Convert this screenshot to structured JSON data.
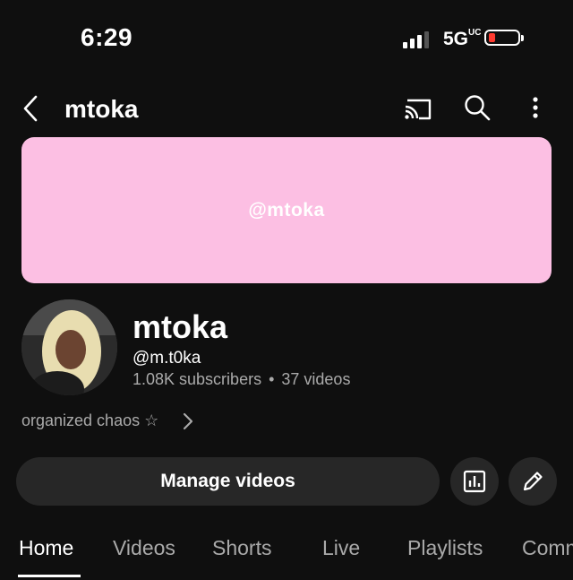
{
  "status_bar": {
    "time": "6:29",
    "network": "5G",
    "network_suffix": "UC",
    "battery_color": "#ff3b30"
  },
  "app_bar": {
    "title": "mtoka",
    "icons": [
      "back-icon",
      "cast-icon",
      "search-icon",
      "more-icon"
    ]
  },
  "banner": {
    "text": "@mtoka",
    "color": "#fcbfe3"
  },
  "channel": {
    "name": "mtoka",
    "handle": "@m.t0ka",
    "subscribers": "1.08K subscribers",
    "separator": "•",
    "videos": "37 videos",
    "description": "organized chaos ☆"
  },
  "actions": {
    "manage_label": "Manage videos",
    "icons": [
      "analytics-icon",
      "edit-icon"
    ]
  },
  "tabs": [
    {
      "label": "Home",
      "active": true
    },
    {
      "label": "Videos",
      "active": false
    },
    {
      "label": "Shorts",
      "active": false
    },
    {
      "label": "Live",
      "active": false
    },
    {
      "label": "Playlists",
      "active": false
    },
    {
      "label": "Comm",
      "active": false
    }
  ]
}
